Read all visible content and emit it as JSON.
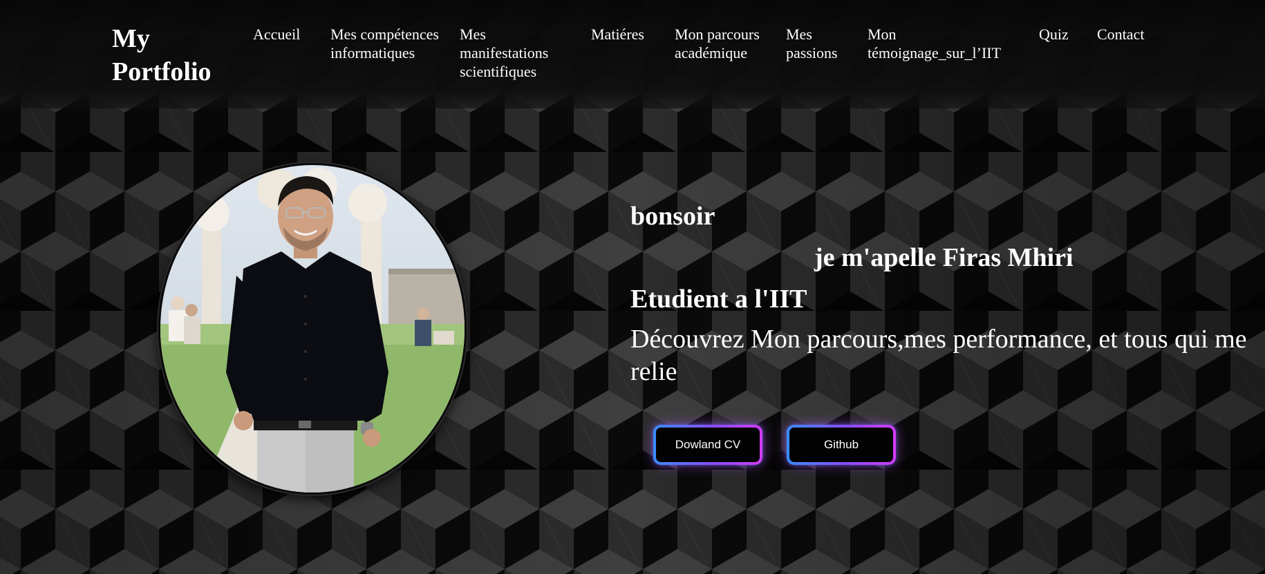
{
  "header": {
    "logo": "My Portfolio",
    "nav": [
      {
        "label": "Accueil"
      },
      {
        "label": "Mes compétences informatiques"
      },
      {
        "label": "Mes manifestations scientifiques"
      },
      {
        "label": "Matiéres"
      },
      {
        "label": "Mon parcours académique"
      },
      {
        "label": "Mes passions"
      },
      {
        "label": "Mon témoignage_sur_l’IIT"
      },
      {
        "label": "Quiz"
      },
      {
        "label": "Contact"
      }
    ]
  },
  "hero": {
    "greeting": "bonsoir",
    "name_line": "je m'apelle Firas Mhiri",
    "role": "Etudient a l'IIT",
    "tagline": "Découvrez Mon parcours,mes performance, et tous qui me relie",
    "buttons": {
      "cv": "Dowland CV",
      "github": "Github"
    }
  },
  "colors": {
    "background_dark": "#0b0b0b",
    "cube_light": "#4a4a4a",
    "cube_mid": "#2a2a2a",
    "cube_dark": "#050505",
    "button_gradient_start": "#3a8cff",
    "button_gradient_end": "#d43bff",
    "text": "#ffffff"
  }
}
